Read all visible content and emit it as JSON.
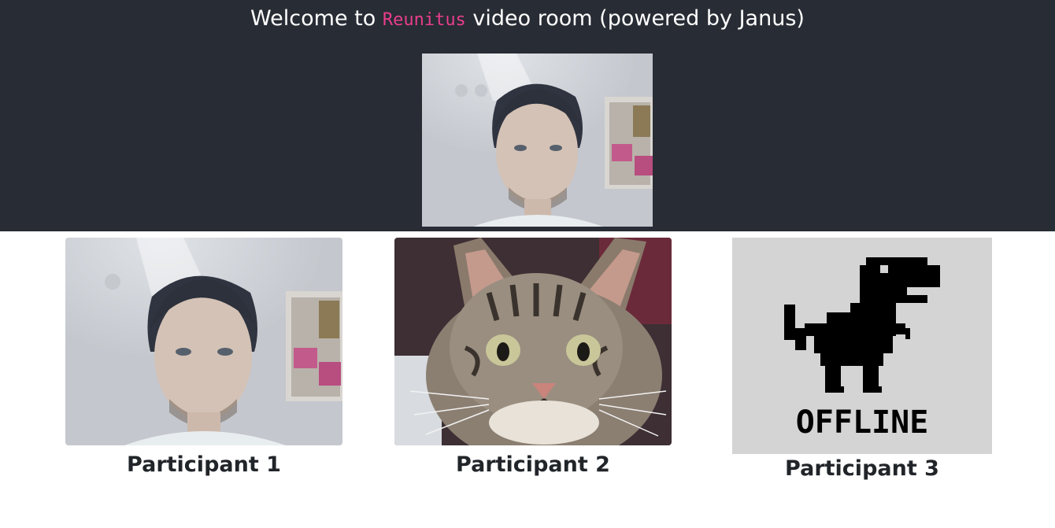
{
  "header": {
    "welcome_prefix": "Welcome to",
    "room_name": "Reunitus",
    "welcome_suffix": "video room (powered by Janus)"
  },
  "participants": [
    {
      "label": "Participant 1",
      "feed": "person-webcam"
    },
    {
      "label": "Participant 2",
      "feed": "tabby-cat"
    },
    {
      "label": "Participant 3",
      "feed": "offline-dinosaur"
    }
  ],
  "offline_text": "OFFLINE",
  "colors": {
    "header_bg": "#282c34",
    "room_name": "#e83e8c",
    "page_bg": "#ffffff"
  }
}
